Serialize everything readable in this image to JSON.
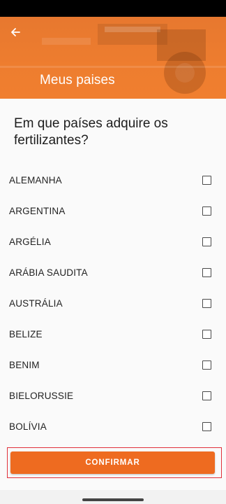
{
  "header": {
    "title": "Meus paises",
    "background_color": "#EE7D2F"
  },
  "question": "Em que países adquire os fertilizantes?",
  "countries": [
    {
      "label": "ALEMANHA",
      "checked": false
    },
    {
      "label": "ARGENTINA",
      "checked": false
    },
    {
      "label": "ARGÉLIA",
      "checked": false
    },
    {
      "label": "ARÁBIA SAUDITA",
      "checked": false
    },
    {
      "label": "AUSTRÁLIA",
      "checked": false
    },
    {
      "label": "BELIZE",
      "checked": false
    },
    {
      "label": "BENIM",
      "checked": false
    },
    {
      "label": "BIELORUSSIE",
      "checked": false
    },
    {
      "label": "BOLÍVIA",
      "checked": false
    }
  ],
  "confirm_button": {
    "label": "CONFIRMAR",
    "color": "#EE6B20"
  },
  "icons": {
    "back": "back-arrow-icon",
    "checkbox": "checkbox-icon"
  }
}
